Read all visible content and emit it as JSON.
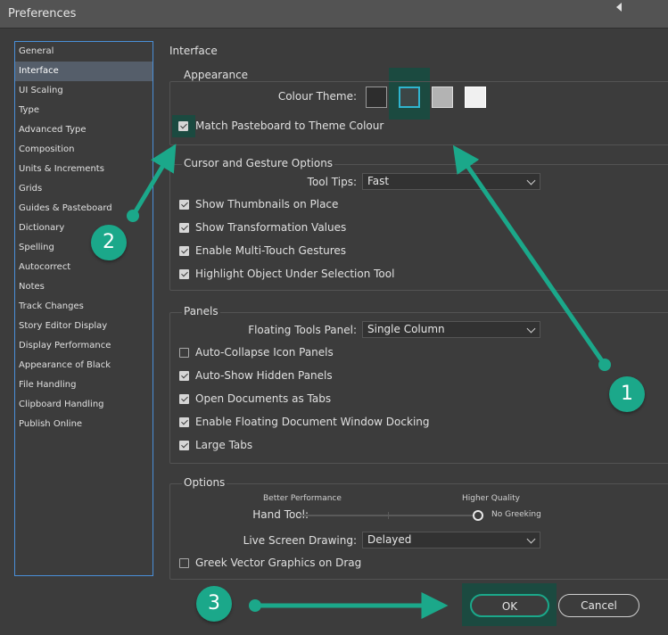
{
  "window": {
    "title": "Preferences"
  },
  "sidebar": {
    "items": [
      {
        "label": "General"
      },
      {
        "label": "Interface",
        "selected": true
      },
      {
        "label": "UI Scaling"
      },
      {
        "label": "Type"
      },
      {
        "label": "Advanced Type"
      },
      {
        "label": "Composition"
      },
      {
        "label": "Units & Increments"
      },
      {
        "label": "Grids"
      },
      {
        "label": "Guides & Pasteboard"
      },
      {
        "label": "Dictionary"
      },
      {
        "label": "Spelling"
      },
      {
        "label": "Autocorrect"
      },
      {
        "label": "Notes"
      },
      {
        "label": "Track Changes"
      },
      {
        "label": "Story Editor Display"
      },
      {
        "label": "Display Performance"
      },
      {
        "label": "Appearance of Black"
      },
      {
        "label": "File Handling"
      },
      {
        "label": "Clipboard Handling"
      },
      {
        "label": "Publish Online"
      }
    ]
  },
  "main": {
    "heading": "Interface",
    "appearance": {
      "title": "Appearance",
      "colour_theme_label": "Colour Theme:",
      "swatches": [
        {
          "name": "dark",
          "color": "#2d2d2d"
        },
        {
          "name": "medium-dark",
          "color": "#3c4646",
          "selected": true
        },
        {
          "name": "medium-light",
          "color": "#b3b3b3"
        },
        {
          "name": "light",
          "color": "#f0f0f0"
        }
      ],
      "match_pasteboard": {
        "label": "Match Pasteboard to Theme Colour",
        "checked": true
      }
    },
    "cursor": {
      "title": "Cursor and Gesture Options",
      "tooltips_label": "Tool Tips:",
      "tooltips_value": "Fast",
      "checkboxes": [
        {
          "label": "Show Thumbnails on Place",
          "checked": true
        },
        {
          "label": "Show Transformation Values",
          "checked": true
        },
        {
          "label": "Enable Multi-Touch Gestures",
          "checked": true
        },
        {
          "label": "Highlight Object Under Selection Tool",
          "checked": true
        }
      ]
    },
    "panels": {
      "title": "Panels",
      "floating_label": "Floating Tools Panel:",
      "floating_value": "Single Column",
      "checkboxes": [
        {
          "label": "Auto-Collapse Icon Panels",
          "checked": false
        },
        {
          "label": "Auto-Show Hidden Panels",
          "checked": true
        },
        {
          "label": "Open Documents as Tabs",
          "checked": true
        },
        {
          "label": "Enable Floating Document Window Docking",
          "checked": true
        },
        {
          "label": "Large Tabs",
          "checked": true
        }
      ]
    },
    "options": {
      "title": "Options",
      "better_performance": "Better Performance",
      "higher_quality": "Higher Quality",
      "hand_tool_label": "Hand Tool:",
      "no_greeking": "No Greeking",
      "hand_tool_level": 1.0,
      "live_drawing_label": "Live Screen Drawing:",
      "live_drawing_value": "Delayed",
      "greek_vector": {
        "label": "Greek Vector Graphics on Drag",
        "checked": false
      }
    }
  },
  "buttons": {
    "ok": "OK",
    "cancel": "Cancel"
  },
  "annotations": {
    "badge1": "1",
    "badge2": "2",
    "badge3": "3"
  },
  "colors": {
    "accent": "#1ba88a",
    "highlight": "#1b4a40",
    "selection": "#4a90d9"
  }
}
